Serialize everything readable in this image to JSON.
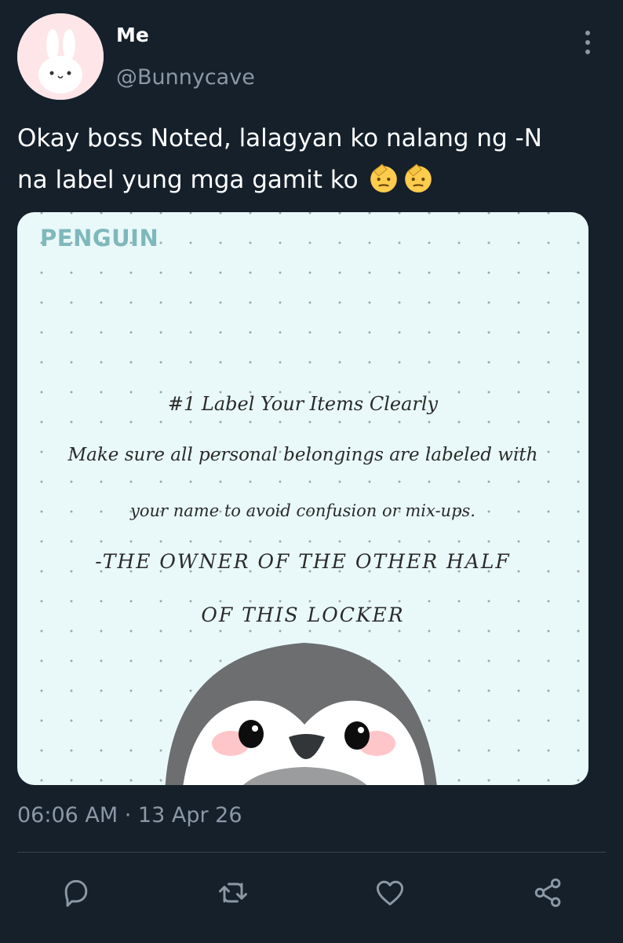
{
  "tweet": {
    "display_name": "Me",
    "handle": "@Bunnycave",
    "text_lines": [
      "Okay boss Noted, lalagyan ko nalang ng -N",
      "na label yung mga gamit ko"
    ],
    "emoji": [
      "saluting-face",
      "saluting-face"
    ],
    "timestamp": "06:06 AM · 13 Apr 26"
  },
  "media": {
    "title": "PENGUIN",
    "heading": "#1 Label Your Items Clearly",
    "body_line1": "Make sure all personal belongings are labeled with",
    "body_line2": "your name to avoid confusion or mix-ups.",
    "signature_line1": "-THE OWNER OF THE OTHER HALF",
    "signature_line2": "OF THIS LOCKER"
  },
  "actions": [
    "reply-icon",
    "retweet-icon",
    "like-icon",
    "share-icon"
  ],
  "colors": {
    "background": "#15202b",
    "secondary_text": "#8b98a5",
    "note_background": "#e9f9f9",
    "title_accent": "#7fb8bc"
  }
}
